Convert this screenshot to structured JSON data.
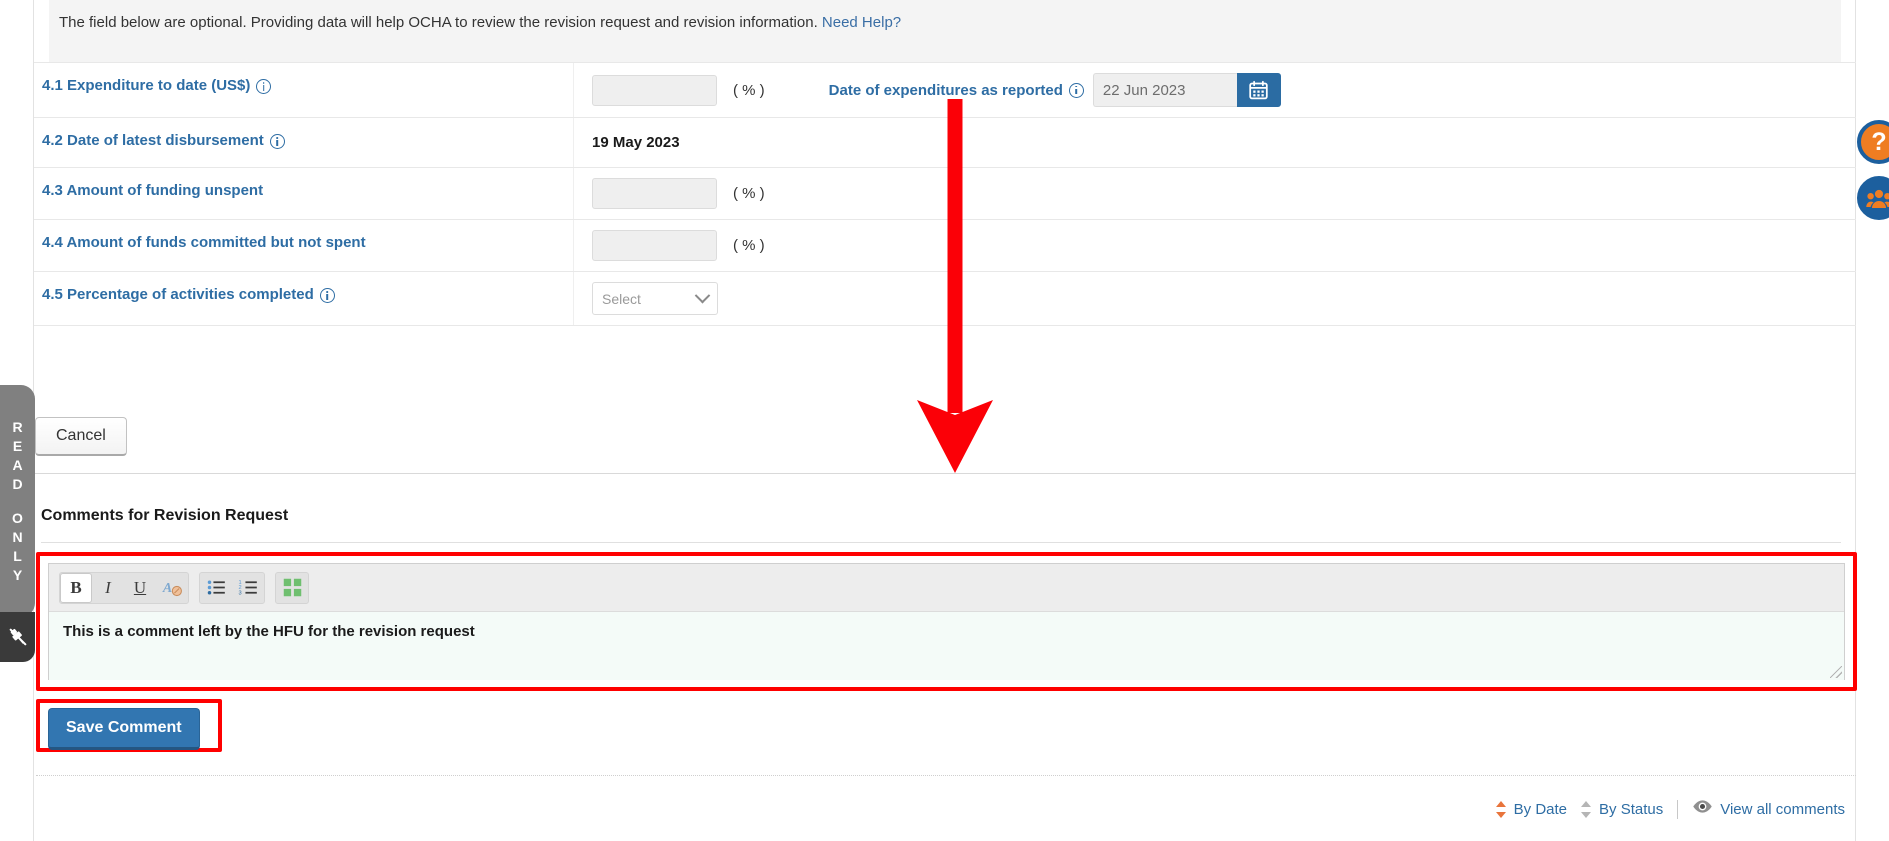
{
  "banner": {
    "text": "The field below are optional. Providing data will help OCHA to review the revision request and revision information.",
    "help_link": "Need Help?"
  },
  "form": {
    "rows": [
      {
        "id": "4.1",
        "label": "4.1 Expenditure to date (US$)",
        "has_info": true,
        "input_value": "",
        "suffix": "( % )",
        "date_label": "Date of expenditures as reported",
        "date_has_info": true,
        "date_value": "22 Jun 2023",
        "date_icon": "calendar-icon"
      },
      {
        "id": "4.2",
        "label": "4.2 Date of latest disbursement",
        "has_info": true,
        "static_value": "19 May 2023"
      },
      {
        "id": "4.3",
        "label": "4.3 Amount of funding unspent",
        "has_info": false,
        "input_value": "",
        "suffix": "( % )"
      },
      {
        "id": "4.4",
        "label": "4.4 Amount of funds committed but not spent",
        "has_info": false,
        "input_value": "",
        "suffix": "( % )"
      },
      {
        "id": "4.5",
        "label": "4.5 Percentage of activities completed",
        "has_info": true,
        "select_value": "Select",
        "select_options": [
          "Select"
        ]
      }
    ]
  },
  "actions": {
    "cancel_label": "Cancel",
    "save_comment_label": "Save Comment"
  },
  "comments": {
    "section_title": "Comments for Revision Request",
    "editor_text": "This is a comment left by the HFU for the revision request",
    "toolbar": [
      {
        "name": "bold-button",
        "glyph": "B",
        "active": true
      },
      {
        "name": "italic-button",
        "glyph": "I",
        "active": false
      },
      {
        "name": "underline-button",
        "glyph": "U",
        "active": false
      },
      {
        "name": "remove-format-button",
        "glyph": "A",
        "active": false
      },
      {
        "name": "bullet-list-button",
        "glyph": "",
        "active": false
      },
      {
        "name": "numbered-list-button",
        "glyph": "",
        "active": false
      },
      {
        "name": "maximize-button",
        "glyph": "",
        "active": false
      }
    ]
  },
  "bottom_bar": {
    "by_date": "By Date",
    "by_status": "By Status",
    "view_all": "View all comments"
  },
  "read_only_tab": {
    "letters": [
      "R",
      "E",
      "A",
      "D",
      "",
      "O",
      "N",
      "L",
      "Y"
    ],
    "text": "READ ONLY"
  },
  "colors": {
    "link_blue": "#2e6da4",
    "primary_button": "#3276b1",
    "accent_orange": "#ef7d22",
    "annotation_red": "#ff0000",
    "panel_grey": "#808080"
  }
}
